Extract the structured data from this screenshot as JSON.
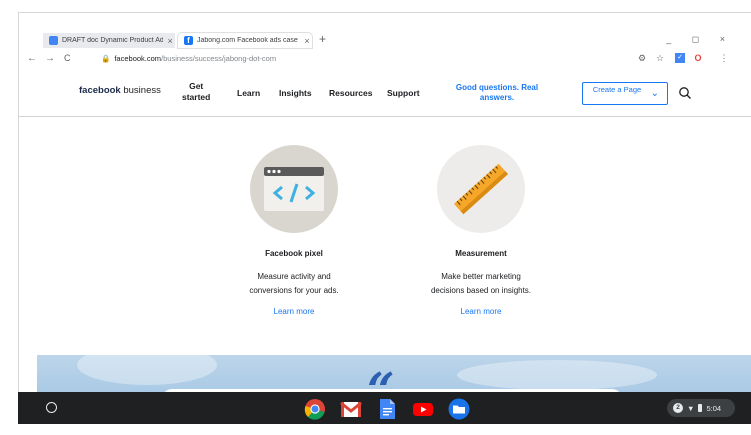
{
  "browser": {
    "tabs": [
      {
        "title": "DRAFT doc Dynamic Product Ad",
        "close": "×"
      },
      {
        "title": "Jabong.com Facebook ads case",
        "close": "×"
      }
    ],
    "new_tab": "+",
    "window_controls": "_ ◻ ×",
    "url_host": "facebook.com",
    "url_path": "/business/success/jabong-dot-com",
    "nav": {
      "back": "←",
      "forward": "→",
      "reload": "C"
    }
  },
  "fb_nav": {
    "logo_bold": "facebook",
    "logo_rest": " business",
    "get_started": "Get\nstarted",
    "learn": "Learn",
    "insights": "Insights",
    "resources": "Resources",
    "support": "Support",
    "good_questions": "Good questions. Real answers.",
    "create_page": "Create a Page"
  },
  "features": [
    {
      "title": "Facebook pixel",
      "desc_line1": "Measure activity and",
      "desc_line2": "conversions for your ads.",
      "link": "Learn more"
    },
    {
      "title": "Measurement",
      "desc_line1": "Make better marketing",
      "desc_line2": "decisions based on insights.",
      "link": "Learn more"
    }
  ],
  "shelf": {
    "apps": [
      "chrome-icon",
      "gmail-icon",
      "docs-icon",
      "youtube-icon",
      "files-icon"
    ],
    "status_time": "5:04",
    "status_badge": "2"
  },
  "colors": {
    "fb_blue": "#1877f2",
    "shelf_bg": "#1f2022",
    "pixel_circle": "#d9d6cf",
    "ruler_orange": "#f6a72a"
  }
}
